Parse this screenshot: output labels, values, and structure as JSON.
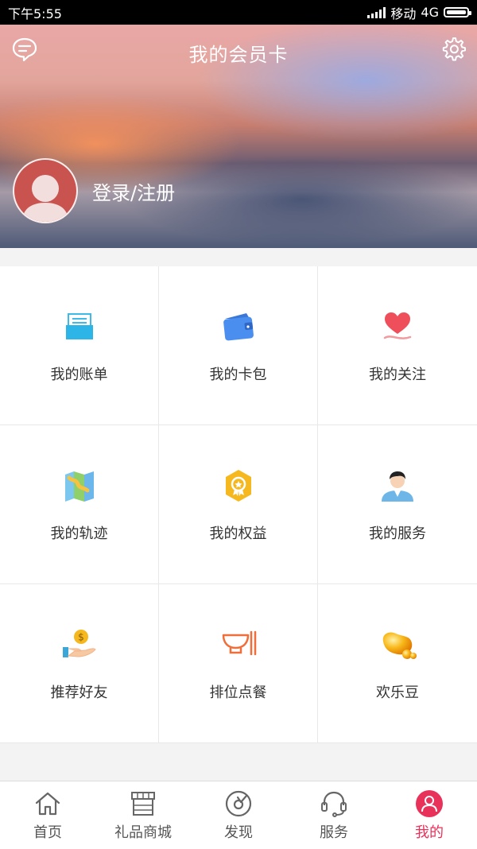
{
  "status_bar": {
    "time": "下午5:55",
    "carrier": "移动",
    "network": "4G"
  },
  "header": {
    "title": "我的会员卡",
    "login_label": "登录/注册"
  },
  "grid": {
    "items": [
      {
        "label": "我的账单",
        "icon": "bill-icon"
      },
      {
        "label": "我的卡包",
        "icon": "wallet-icon"
      },
      {
        "label": "我的关注",
        "icon": "heart-icon"
      },
      {
        "label": "我的轨迹",
        "icon": "map-icon"
      },
      {
        "label": "我的权益",
        "icon": "badge-icon"
      },
      {
        "label": "我的服务",
        "icon": "person-icon"
      },
      {
        "label": "推荐好友",
        "icon": "coin-hand-icon"
      },
      {
        "label": "排位点餐",
        "icon": "bowl-icon"
      },
      {
        "label": "欢乐豆",
        "icon": "gold-beans-icon"
      }
    ]
  },
  "tabbar": {
    "items": [
      {
        "label": "首页",
        "icon": "home-icon"
      },
      {
        "label": "礼品商城",
        "icon": "store-icon"
      },
      {
        "label": "发现",
        "icon": "compass-icon"
      },
      {
        "label": "服务",
        "icon": "headset-icon"
      },
      {
        "label": "我的",
        "icon": "user-icon"
      }
    ],
    "active": "我的"
  },
  "colors": {
    "accent": "#e8325a",
    "header_text": "#ffffff",
    "label_text": "#333333"
  }
}
